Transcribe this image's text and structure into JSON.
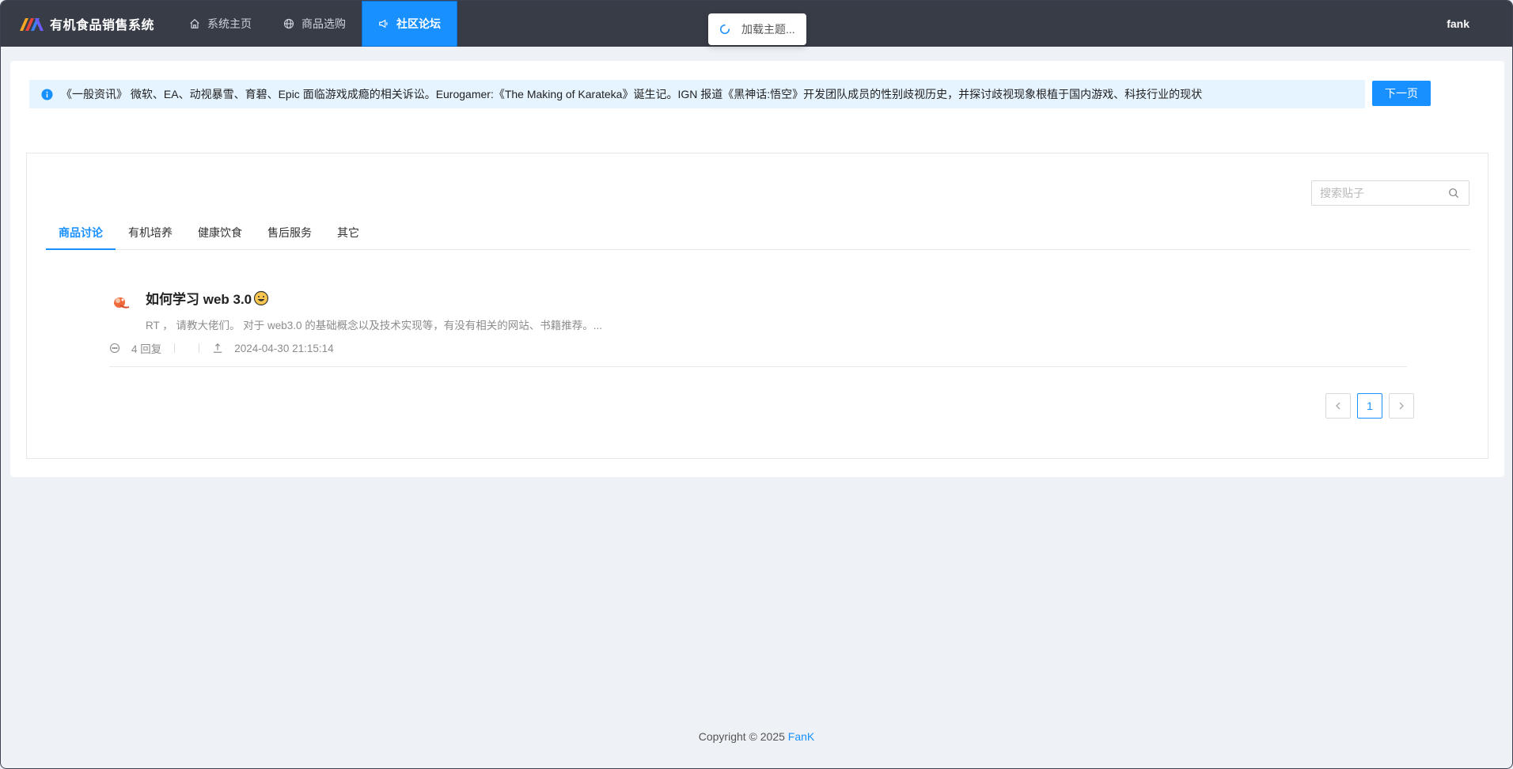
{
  "app": {
    "title": "有机食品销售系统"
  },
  "nav": {
    "items": [
      {
        "label": "系统主页",
        "icon": "home-icon"
      },
      {
        "label": "商品选购",
        "icon": "globe-icon"
      },
      {
        "label": "社区论坛",
        "icon": "megaphone-icon",
        "active": true
      }
    ]
  },
  "user": {
    "name": "fank"
  },
  "toast": {
    "text": "加载主题..."
  },
  "notice": {
    "text": "《一般资讯》 微软、EA、动视暴雪、育碧、Epic 面临游戏成瘾的相关诉讼。Eurogamer:《The Making of Karateka》诞生记。IGN 报道《黑神话:悟空》开发团队成员的性别歧视历史，并探讨歧视现象根植于国内游戏、科技行业的现状",
    "next_label": "下一页"
  },
  "search": {
    "placeholder": "搜索贴子"
  },
  "tabs": [
    {
      "label": "商品讨论",
      "active": true
    },
    {
      "label": "有机培养"
    },
    {
      "label": "健康饮食"
    },
    {
      "label": "售后服务"
    },
    {
      "label": "其它"
    }
  ],
  "posts": [
    {
      "title": "如何学习 web 3.0",
      "excerpt": "RT ，  请教大佬们。 对于 web3.0 的基础概念以及技术实现等，有没有相关的网站、书籍推荐。...",
      "replies": "4 回复",
      "time": "2024-04-30 21:15:14"
    }
  ],
  "pagination": {
    "current": "1"
  },
  "footer": {
    "prefix": "Copyright © 2025 ",
    "author": "FanK"
  },
  "colors": {
    "header_bg": "#383c47",
    "accent": "#1890ff",
    "page_bg": "#eef1f5",
    "notice_bg": "#e6f4ff"
  }
}
